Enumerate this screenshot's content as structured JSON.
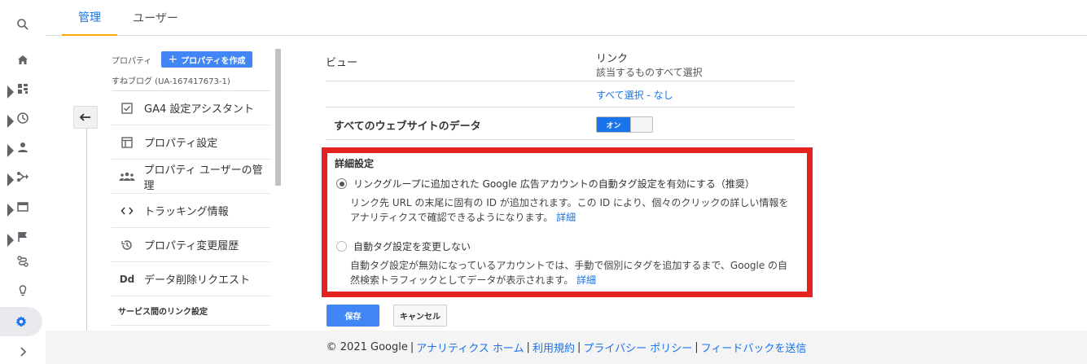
{
  "tabs": {
    "admin": "管理",
    "user": "ユーザー"
  },
  "property": {
    "label": "プロパティ",
    "create_button": "プロパティを作成",
    "name": "すねブログ (UA-167417673-1)",
    "menu": [
      {
        "label": "GA4 設定アシスタント",
        "icon": "checkbox-icon"
      },
      {
        "label": "プロパティ設定",
        "icon": "layout-icon"
      },
      {
        "label": "プロパティ ユーザーの管理",
        "icon": "people-icon"
      },
      {
        "label": "トラッキング情報",
        "icon": "code-icon"
      },
      {
        "label": "プロパティ変更履歴",
        "icon": "history-icon"
      },
      {
        "label": "データ削除リクエスト",
        "icon": "dd-icon"
      }
    ],
    "section_title": "サービス間のリンク設定",
    "dd_glyph": "Dd"
  },
  "settings": {
    "view_label": "ビュー",
    "link_title": "リンク",
    "link_subtitle": "該当するものすべて選択",
    "select_all": "すべて選択",
    "select_none": "なし",
    "select_sep": " - ",
    "all_website_data": "すべてのウェブサイトのデータ",
    "toggle_on_label": "オン",
    "advanced_title": "詳細設定",
    "option1_label": "リンクグループに追加された Google 広告アカウントの自動タグ設定を有効にする（推奨）",
    "option1_desc": "リンク先 URL の末尾に固有の ID が追加されます。この ID により、個々のクリックの詳しい情報をアナリティクスで確認できるようになります。",
    "option1_more": "詳細",
    "option2_label": "自動タグ設定を変更しない",
    "option2_desc": "自動タグ設定が無効になっているアカウントでは、手動で個別にタグを追加するまで、Google の自然検索トラフィックとしてデータが表示されます。",
    "option2_more": "詳細",
    "save": "保存",
    "cancel": "キャンセル"
  },
  "footer": {
    "copyright": "© 2021 Google",
    "links": [
      "アナリティクス ホーム",
      "利用規約",
      "プライバシー ポリシー",
      "フィードバックを送信"
    ]
  },
  "colors": {
    "accent": "#1a73e8",
    "highlight": "#e52222",
    "tab_underline": "#f9ab00"
  }
}
